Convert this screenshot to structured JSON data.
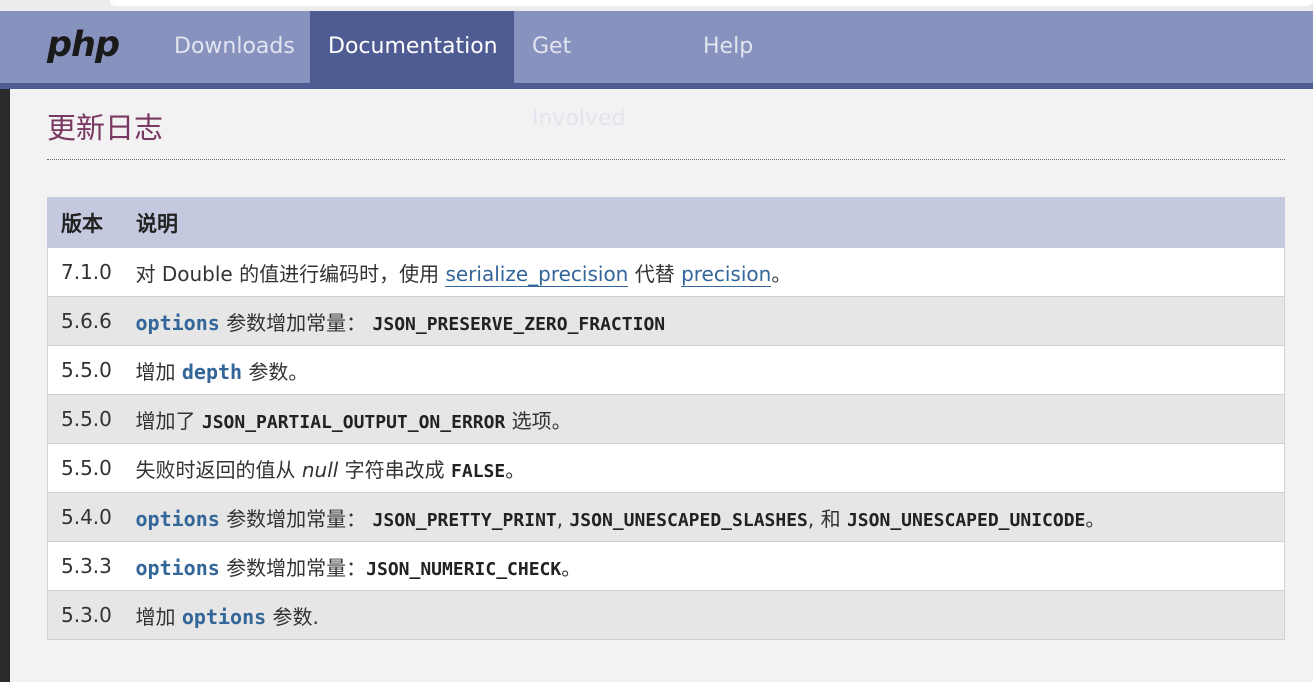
{
  "nav": {
    "logo": "php",
    "items": [
      {
        "label": "Downloads",
        "active": false
      },
      {
        "label": "Documentation",
        "active": true
      },
      {
        "label": "Get Involved",
        "active": false
      },
      {
        "label": "Help",
        "active": false
      }
    ]
  },
  "page": {
    "title": "更新日志"
  },
  "table": {
    "headers": [
      "版本",
      "说明"
    ],
    "rows": [
      {
        "version": "7.1.0",
        "parts": [
          "对 Double 的值进行编码时，使用 ",
          "serialize_precision",
          " 代替 ",
          "precision",
          "。"
        ]
      },
      {
        "version": "5.6.6",
        "parts": [
          "options",
          " 参数增加常量： ",
          "JSON_PRESERVE_ZERO_FRACTION"
        ]
      },
      {
        "version": "5.5.0",
        "parts": [
          "增加 ",
          "depth",
          " 参数。"
        ]
      },
      {
        "version": "5.5.0",
        "parts": [
          "增加了 ",
          "JSON_PARTIAL_OUTPUT_ON_ERROR",
          " 选项。"
        ]
      },
      {
        "version": "5.5.0",
        "parts": [
          "失败时返回的值从 ",
          "null",
          " 字符串改成 ",
          "FALSE",
          "。"
        ]
      },
      {
        "version": "5.4.0",
        "parts": [
          "options",
          " 参数增加常量： ",
          "JSON_PRETTY_PRINT",
          ", ",
          "JSON_UNESCAPED_SLASHES",
          ", 和 ",
          "JSON_UNESCAPED_UNICODE",
          "。"
        ]
      },
      {
        "version": "5.3.3",
        "parts": [
          "options",
          " 参数增加常量：",
          "JSON_NUMERIC_CHECK",
          "。"
        ]
      },
      {
        "version": "5.3.0",
        "parts": [
          "增加 ",
          "options",
          " 参数."
        ]
      }
    ]
  },
  "colors": {
    "nav_bg": "#8892bf",
    "nav_active": "#4f5b93",
    "title": "#793862",
    "link": "#336699",
    "table_header": "#c4c9df"
  }
}
